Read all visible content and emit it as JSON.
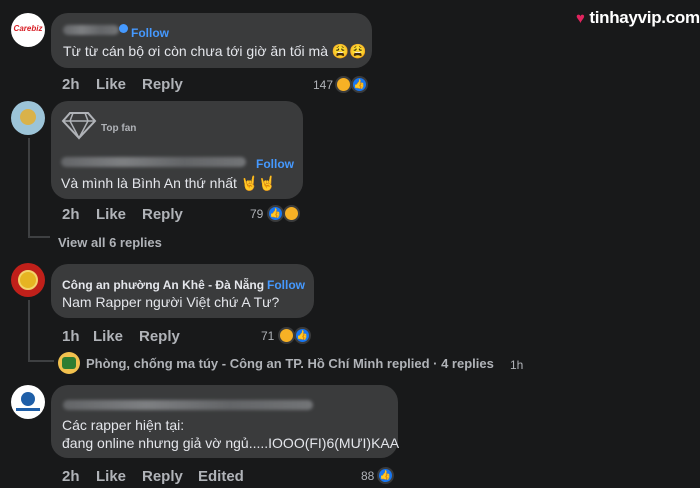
{
  "watermark": {
    "brand": "tinhayvip.com",
    "heart_color": "#e0245e"
  },
  "comments": [
    {
      "avatar_logo": "Carebiz",
      "follow": "Follow",
      "text": "Từ từ cán bộ ơi còn chưa tới giờ ăn tối mà 😩😩",
      "time": "2h",
      "like": "Like",
      "reply": "Reply",
      "reaction_count": "147",
      "reactions": [
        "haha",
        "like"
      ]
    },
    {
      "badge": "Top fan",
      "follow": "Follow",
      "text": "Và mình là Bình An thứ nhất 🤘🤘",
      "time": "2h",
      "like": "Like",
      "reply": "Reply",
      "reaction_count": "79",
      "reactions": [
        "like",
        "haha"
      ],
      "view_replies": "View all 6 replies"
    },
    {
      "author": "Công an phường An Khê - Đà Nẵng",
      "follow": "Follow",
      "text": "Nam Rapper người Việt chứ A Tư?",
      "time": "1h",
      "like": "Like",
      "reply": "Reply",
      "reaction_count": "71",
      "reactions": [
        "haha",
        "like"
      ],
      "replied_by": "Phòng, chống ma túy - Công an TP. Hồ Chí Minh replied · 4 replies",
      "replied_time": "1h"
    },
    {
      "text_line1": "Các rapper hiện tại:",
      "text_line2": "đang online nhưng giả vờ ngủ.....IOOO(FI)6(MƯI)KAA",
      "time": "2h",
      "like": "Like",
      "reply": "Reply",
      "edited": "Edited",
      "reaction_count": "88",
      "reactions": [
        "like"
      ]
    }
  ]
}
